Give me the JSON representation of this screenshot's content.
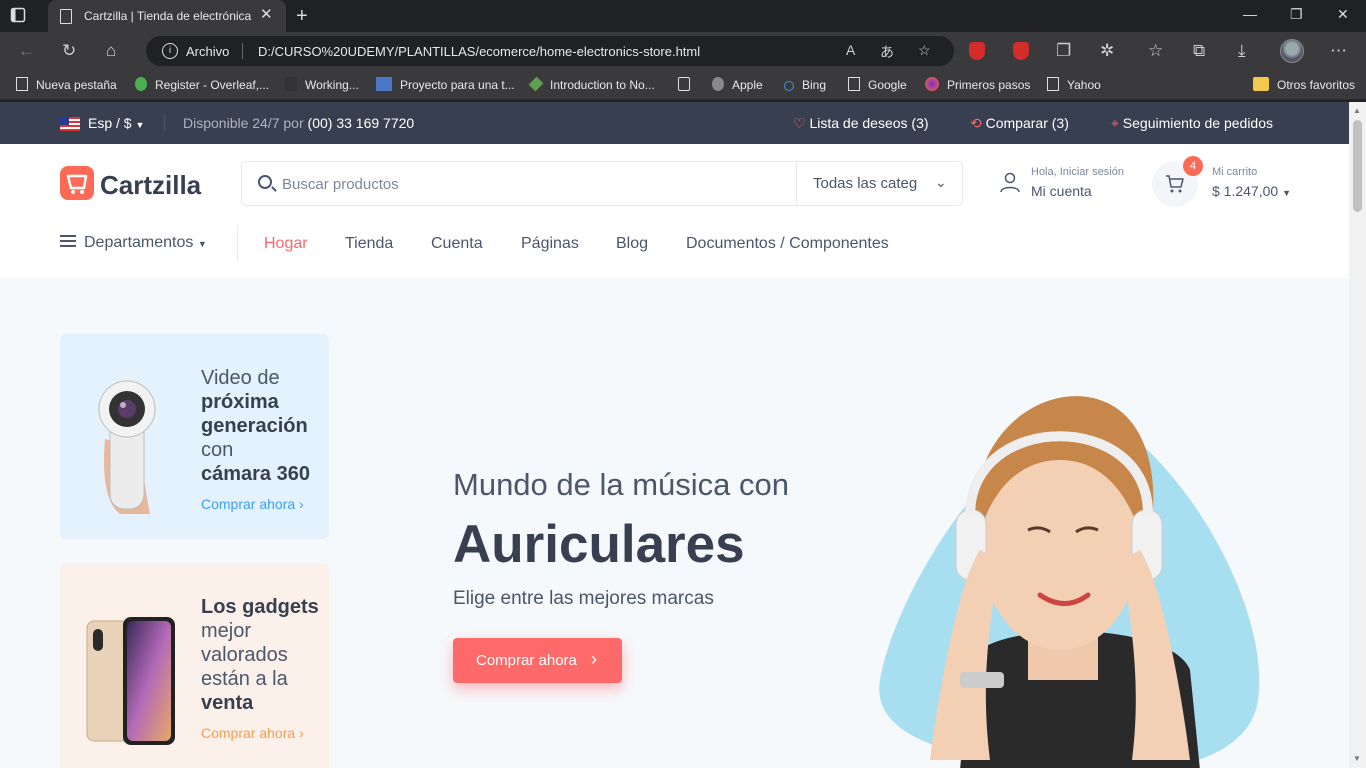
{
  "browser": {
    "tab_title": "Cartzilla | Tienda de electrónica",
    "address_scheme": "Archivo",
    "url": "D:/CURSO%20UDEMY/PLANTILLAS/ecomerce/home-electronics-store.html"
  },
  "bookmarks": [
    {
      "label": "Nueva pestaña",
      "icon": "page-icon"
    },
    {
      "label": "Register - Overleaf,...",
      "icon": "leaf-icon"
    },
    {
      "label": "Working...",
      "icon": "working-icon"
    },
    {
      "label": "Proyecto para una t...",
      "icon": "uoc-icon"
    },
    {
      "label": "Introduction to No...",
      "icon": "node-icon"
    },
    {
      "label": "",
      "icon": "calendar-icon"
    },
    {
      "label": "Apple",
      "icon": "apple-icon"
    },
    {
      "label": "Bing",
      "icon": "search-icon"
    },
    {
      "label": "Google",
      "icon": "page-icon"
    },
    {
      "label": "Primeros pasos",
      "icon": "firefox-icon"
    },
    {
      "label": "Yahoo",
      "icon": "page-icon"
    }
  ],
  "bookmarks_other": "Otros favoritos",
  "topbar": {
    "currency": "Esp / $",
    "availability_prefix": "Disponible 24/7 por",
    "phone": "(00) 33 169 7720",
    "wishlist": "Lista de deseos (3)",
    "compare": "Comparar (3)",
    "tracking": "Seguimiento de pedidos"
  },
  "header": {
    "logo": "Cartzilla",
    "search_placeholder": "Buscar productos",
    "category_select": "Todas las categorías",
    "account_small": "Hola, Iniciar sesión",
    "account_main": "Mi cuenta",
    "cart_count": "4",
    "cart_small": "Mi carrito",
    "cart_total": "$ 1.247,00"
  },
  "nav": {
    "departments": "Departamentos",
    "items": [
      "Hogar",
      "Tienda",
      "Cuenta",
      "Páginas",
      "Blog",
      "Documentos / Componentes"
    ]
  },
  "promos": [
    {
      "line1": "Video de",
      "bold1": "próxima generación",
      "line2": "con",
      "bold2": "cámara 360",
      "link": "Comprar ahora",
      "color": "#3e9df5"
    },
    {
      "bold1": "Los gadgets",
      "line1": "mejor valorados están a la",
      "bold2": "venta",
      "link": "Comprar ahora",
      "color": "#fd9a4d"
    }
  ],
  "hero": {
    "subtitle": "Mundo de la música con",
    "title": "Auriculares",
    "description": "Elige entre las mejores marcas",
    "button": "Comprar ahora"
  },
  "colors": {
    "accent": "#fe696a",
    "topbar": "#373f50",
    "hero_blob": "#a8dff0"
  }
}
